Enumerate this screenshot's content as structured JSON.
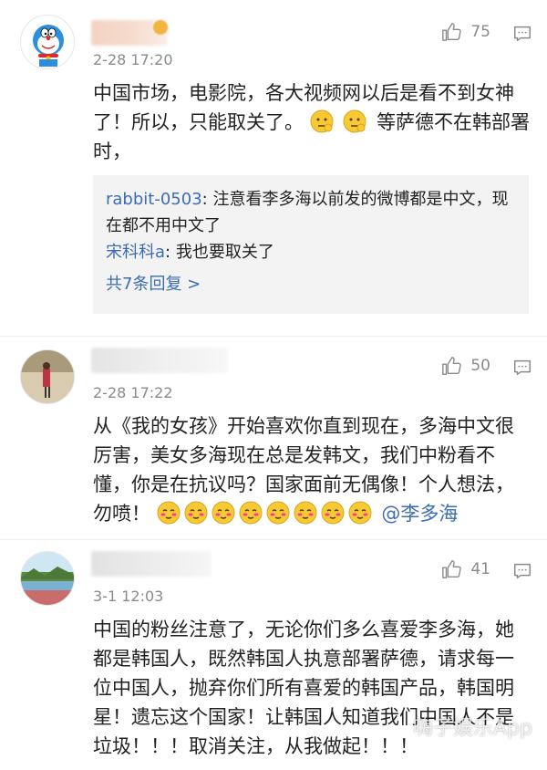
{
  "comments": [
    {
      "time": "2-28 17:20",
      "likes": "75",
      "text_a": "中国市场，电影院，各大视频网以后是看不到女神了！所以，只能取关了。",
      "text_b": "等萨德不在韩部署时，",
      "replies": [
        {
          "name": "rabbit-0503",
          "text": ": 注意看李多海以前发的微博都是中文，现在都不用中文了"
        },
        {
          "name": "宋科科a",
          "text": ": 我也要取关了"
        }
      ],
      "more": "共7条回复 >"
    },
    {
      "time": "2-28 17:22",
      "likes": "50",
      "text": "从《我的女孩》开始喜欢你直到现在，多海中文很厉害，美女多海现在总是发韩文，我们中粉看不懂，你是在抗议吗？国家面前无偶像！个人想法，勿喷！",
      "mention": "@李多海"
    },
    {
      "time": "3-1 12:03",
      "likes": "41",
      "text": "中国的粉丝注意了，无论你们多么喜爱李多海，她都是韩国人，既然韩国人执意部署萨德，请求每一位中国人，抛弃你们所有喜爱的韩国产品，韩国明星！遗忘这个国家！让韩国人知道我们中国人不是垃圾！！！取消关注，从我做起！！！"
    }
  ],
  "watermark": "嗨子娱乐App",
  "icons": {
    "like": "thumbs-up-icon",
    "reply": "comment-icon",
    "emoji_think": "thinking-face-icon",
    "emoji_shy": "shy-face-icon"
  },
  "colors": {
    "link": "#3c6cb4",
    "meta": "#8a8a8a",
    "reply_bg": "#f3f3f3"
  }
}
